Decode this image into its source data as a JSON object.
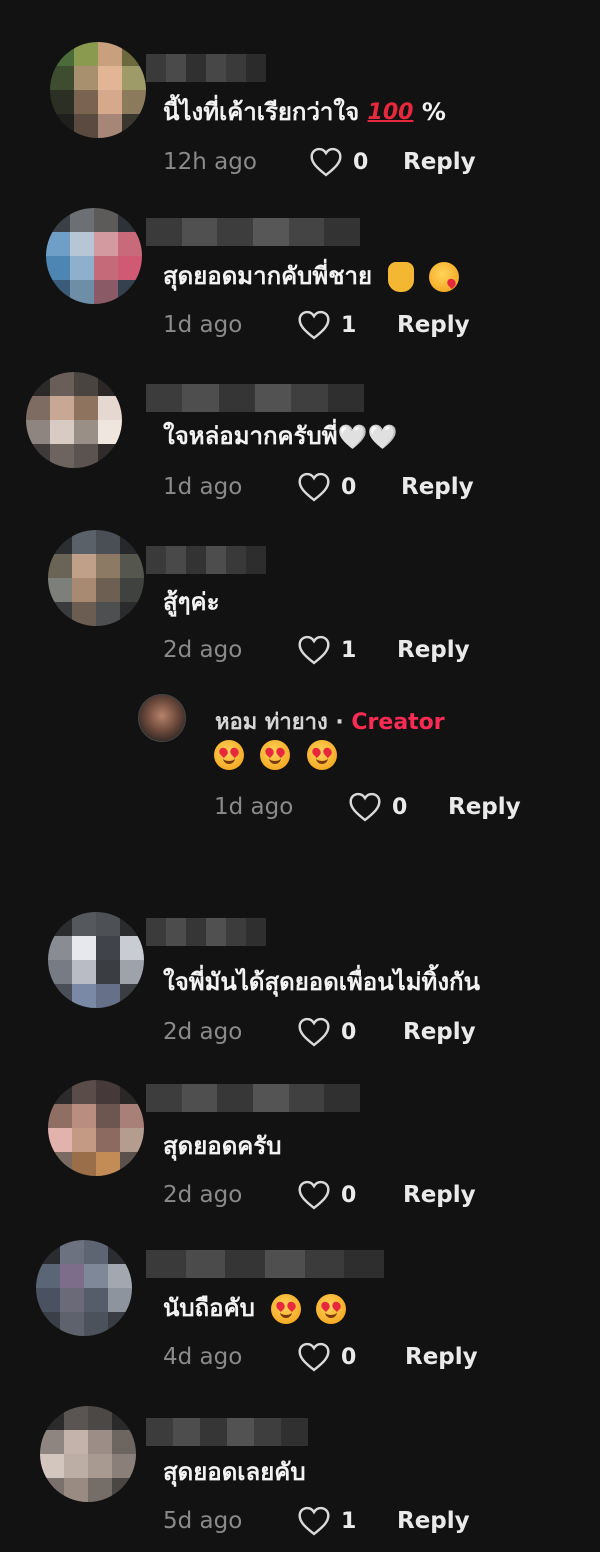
{
  "comments": [
    {
      "text": "นี้ไงที่เค้าเรียกว่าใจ",
      "emoji": [
        "hundred-points",
        "percent"
      ],
      "suffix": "%",
      "time": "12h ago",
      "likes": "0",
      "reply": "Reply",
      "avatar": [
        "#4b6b3a",
        "#8a9a4f",
        "#c9a07d",
        "#6b6a3e",
        "#3e4d30",
        "#a88f6d",
        "#e2b597",
        "#9e9b68",
        "#2c2f24",
        "#7a6350",
        "#d7a98c",
        "#8b7a5b",
        "#1f1f1c",
        "#5a4a40",
        "#a68677",
        "#3a372f"
      ],
      "name_blur": [
        "#3a3a3a",
        "#4a4a4a",
        "#303030",
        "#474747",
        "#3a3a3a",
        "#2b2b2b"
      ]
    },
    {
      "text": "สุดยอดมากคับพี่ชาย",
      "emoji": [
        "love-you-hand",
        "face-blowing-kiss"
      ],
      "time": "1d ago",
      "likes": "1",
      "reply": "Reply",
      "avatar": [
        "#3b4048",
        "#6c6f73",
        "#5c5b5a",
        "#2e3238",
        "#6f9fc6",
        "#b7c6d4",
        "#d39a9f",
        "#c96a7a",
        "#4d86b3",
        "#8fb0cc",
        "#c46a78",
        "#d05a74",
        "#3a5c7a",
        "#6e8ea8",
        "#8a5a66",
        "#35414f"
      ],
      "name_blur": [
        "#3a3a3a",
        "#505050",
        "#3d3d3d",
        "#575757",
        "#444444",
        "#333333"
      ]
    },
    {
      "text": "ใจหล่อมากครับพี่",
      "emoji": [
        "white-heart",
        "white-heart"
      ],
      "hearts": "🤍🤍",
      "time": "1d ago",
      "likes": "0",
      "reply": "Reply",
      "avatar": [
        "#2c2a29",
        "#6a5f58",
        "#4a4441",
        "#2a2726",
        "#7e6c62",
        "#c8a894",
        "#8e735f",
        "#e4d8d0",
        "#8f8580",
        "#d8cbc3",
        "#9a8f87",
        "#efe6e0",
        "#3e3b3a",
        "#6d6460",
        "#5a5350",
        "#2f2c2b"
      ],
      "name_blur": [
        "#3c3c3c",
        "#4e4e4e",
        "#353535",
        "#525252",
        "#3f3f3f",
        "#2f2f2f"
      ]
    },
    {
      "text": "สู้ๆค่ะ",
      "time": "2d ago",
      "likes": "1",
      "reply": "Reply",
      "avatar": [
        "#2d2e30",
        "#5b6168",
        "#4a4e55",
        "#26282a",
        "#6a6457",
        "#c0a088",
        "#8d7a65",
        "#55574f",
        "#7d7f7a",
        "#a88a73",
        "#6d5f52",
        "#3f423f",
        "#3a3b3d",
        "#6c5d52",
        "#4d4f51",
        "#2a2b2c"
      ],
      "name_blur": [
        "#3a3a3a",
        "#494949",
        "#333333",
        "#4d4d4d",
        "#393939",
        "#2d2d2d"
      ],
      "creator_reply": {
        "name": "หอม ท่ายาง",
        "separator": " · ",
        "badge": "Creator",
        "time": "1d ago",
        "likes": "0",
        "reply": "Reply",
        "emoji": [
          "smiling-face-with-hearts",
          "smiling-face-with-hearts",
          "smiling-face-with-hearts"
        ]
      }
    },
    {
      "text": "ใจพี่มันได้สุดยอดเพื่อนไม่ทิ้งกัน",
      "time": "2d ago",
      "likes": "0",
      "reply": "Reply",
      "avatar": [
        "#2b2c2e",
        "#55585d",
        "#4d5055",
        "#2a2b2c",
        "#8a8c93",
        "#e6e8ee",
        "#40444a",
        "#c9ccd3",
        "#777b84",
        "#b9bcc4",
        "#3a3d42",
        "#9ea2aa",
        "#4a4e56",
        "#7a8aa6",
        "#667089",
        "#3a3d42"
      ],
      "name_blur": [
        "#3b3b3b",
        "#4c4c4c",
        "#363636",
        "#505050",
        "#3c3c3c",
        "#2f2f2f"
      ]
    },
    {
      "text": "สุดยอดครับ",
      "time": "2d ago",
      "likes": "0",
      "reply": "Reply",
      "avatar": [
        "#2c2a2a",
        "#5a4c48",
        "#45393a",
        "#2a2727",
        "#8f6e64",
        "#b98d7f",
        "#6e5650",
        "#a88077",
        "#e2b2ad",
        "#c49a85",
        "#8c6a60",
        "#b49c8e",
        "#7a6a62",
        "#9a6e48",
        "#c38b55",
        "#5a514c"
      ],
      "name_blur": [
        "#3d3d3d",
        "#4f4f4f",
        "#373737",
        "#545454",
        "#404040",
        "#303030"
      ]
    },
    {
      "text": "นับถือคับ",
      "emoji": [
        "smiling-face-with-hearts",
        "smiling-face-with-hearts"
      ],
      "time": "4d ago",
      "likes": "0",
      "reply": "Reply",
      "avatar": [
        "#2a2c30",
        "#6c7280",
        "#5e6572",
        "#2b2d31",
        "#5a6575",
        "#7d6d8a",
        "#7f8896",
        "#a2a7b0",
        "#4a5160",
        "#6a6a78",
        "#565d6a",
        "#8e949e",
        "#3b4048",
        "#5d626d",
        "#4c525c",
        "#3a3d44"
      ],
      "name_blur": [
        "#3a3a3a",
        "#4b4b4b",
        "#353535",
        "#4f4f4f",
        "#3b3b3b",
        "#2e2e2e"
      ]
    },
    {
      "text": "สุดยอดเลยคับ",
      "time": "5d ago",
      "likes": "1",
      "reply": "Reply",
      "avatar": [
        "#2c2b2b",
        "#5a5553",
        "#4c4846",
        "#2b2a2a",
        "#8f8580",
        "#c4b3aa",
        "#9c8e87",
        "#6d6560",
        "#d3c6bf",
        "#bcaea5",
        "#a89a91",
        "#8a7f79",
        "#7a716c",
        "#9a8b82",
        "#756d68",
        "#4a4644"
      ],
      "name_blur": [
        "#3c3c3c",
        "#4d4d4d",
        "#363636",
        "#525252",
        "#3e3e3e",
        "#303030"
      ]
    }
  ],
  "colors": {
    "background": "#121212",
    "creator_badge": "#fe2c55",
    "time": "#8a8a8a"
  }
}
